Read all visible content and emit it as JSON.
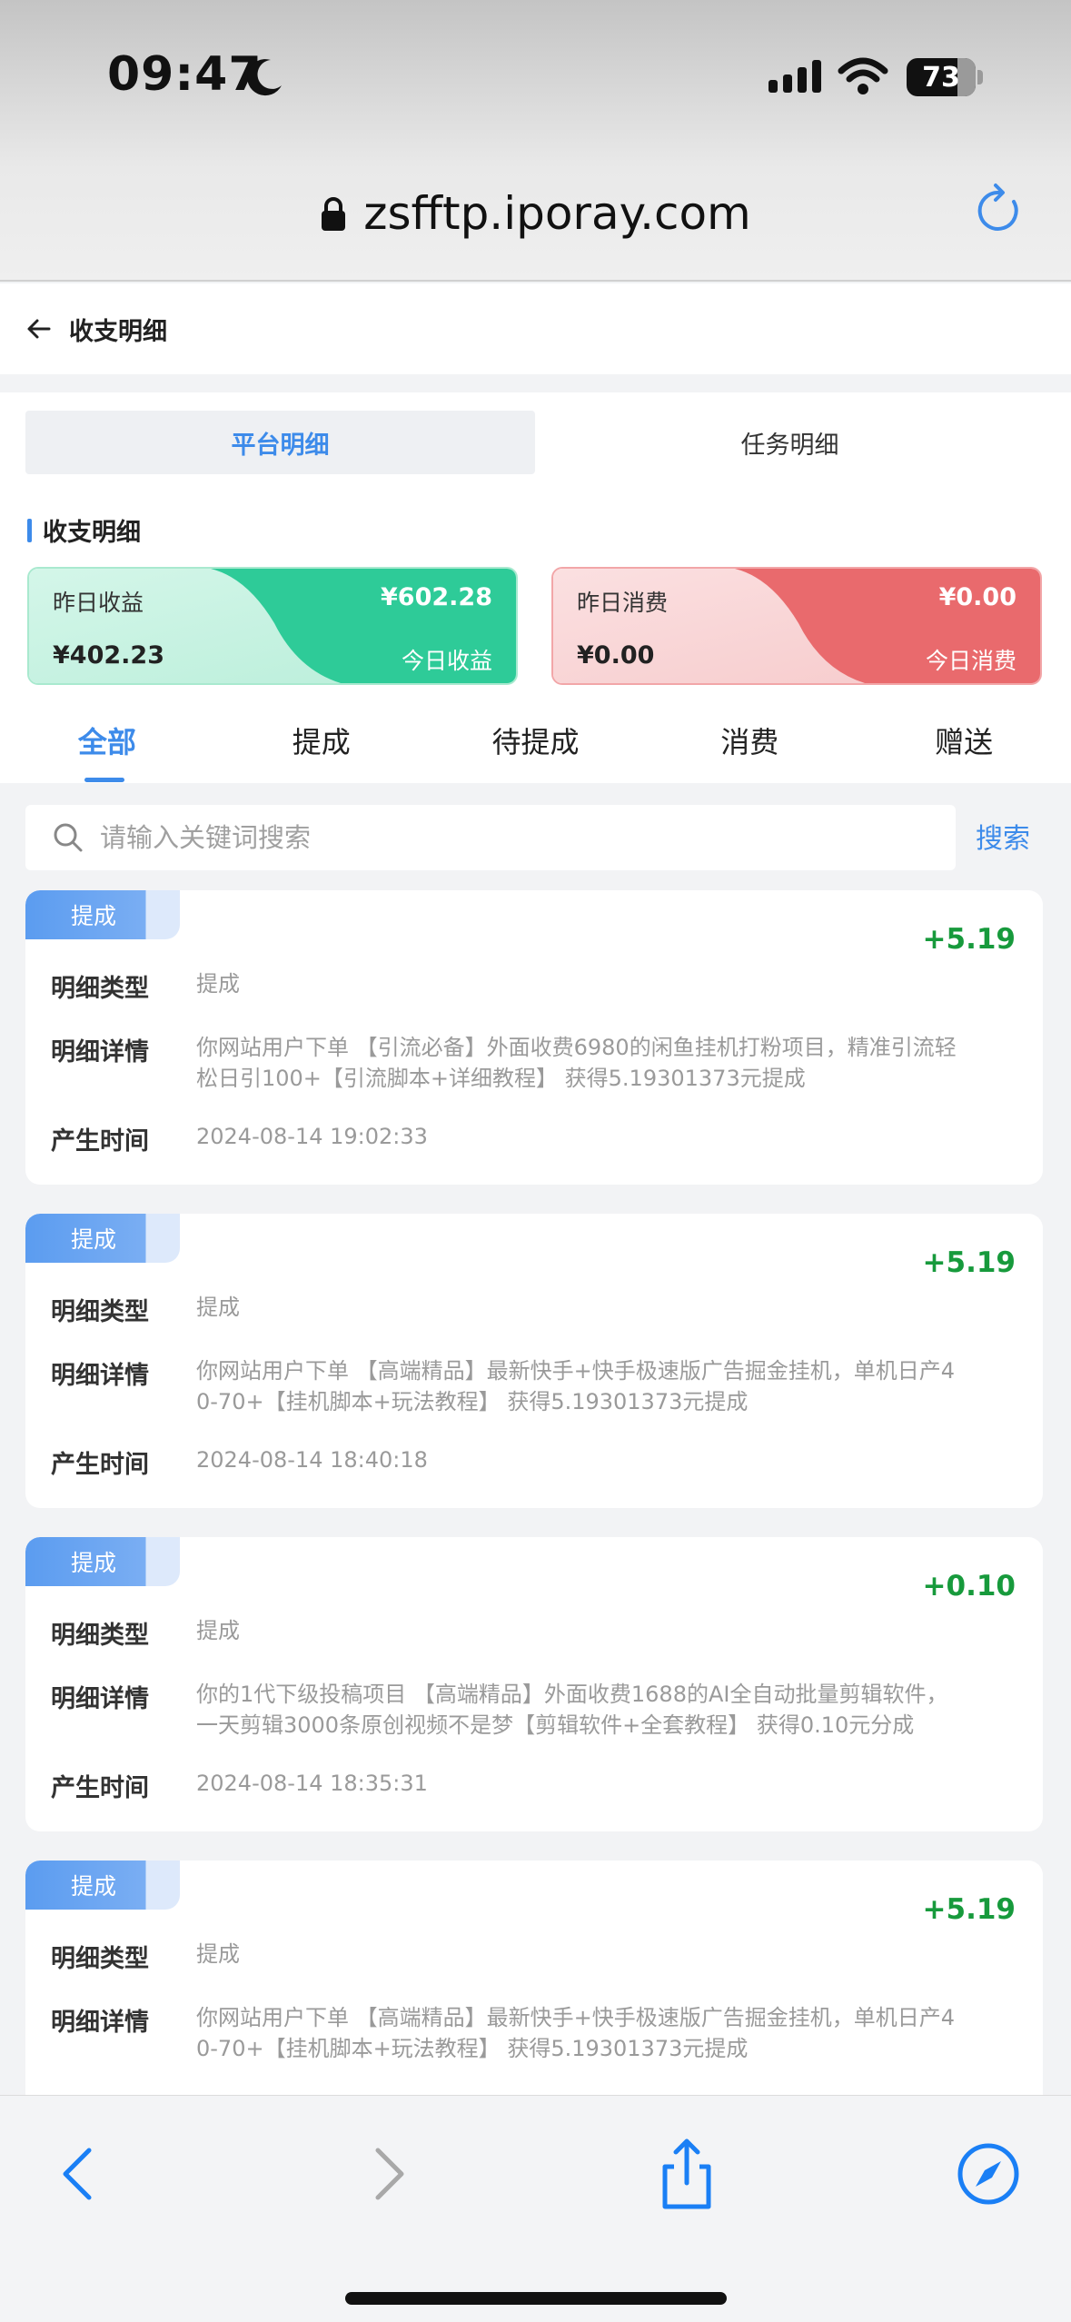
{
  "status": {
    "time": "09:47",
    "battery": "73"
  },
  "browser": {
    "url": "zsfftp.iporay.com"
  },
  "header": {
    "title": "收支明细"
  },
  "seg_tabs": [
    {
      "label": "平台明细",
      "active": true
    },
    {
      "label": "任务明细",
      "active": false
    }
  ],
  "section_title": "收支明细",
  "summary": {
    "green": {
      "top_left_label": "昨日收益",
      "top_right_amount": "¥602.28",
      "bottom_left_amount": "¥402.23",
      "bottom_right_label": "今日收益",
      "color": "#2ecb98"
    },
    "red": {
      "top_left_label": "昨日消费",
      "top_right_amount": "¥0.00",
      "bottom_left_amount": "¥0.00",
      "bottom_right_label": "今日消费",
      "color": "#e96a6d"
    }
  },
  "filter_tabs": [
    "全部",
    "提成",
    "待提成",
    "消费",
    "赠送"
  ],
  "search": {
    "placeholder": "请输入关键词搜索",
    "value": "",
    "button": "搜索"
  },
  "records": [
    {
      "tag": "提成",
      "amount": "+5.19",
      "type_label": "明细类型",
      "type_value": "提成",
      "detail_label": "明细详情",
      "detail_line1": "你网站用户下单 【引流必备】外面收费6980的闲鱼挂机打粉项目，精准引流轻",
      "detail_line2": "松日引100+【引流脚本+详细教程】 获得5.19301373元提成",
      "time_label": "产生时间",
      "time_value": "2024-08-14 19:02:33"
    },
    {
      "tag": "提成",
      "amount": "+5.19",
      "type_label": "明细类型",
      "type_value": "提成",
      "detail_label": "明细详情",
      "detail_line1": "你网站用户下单 【高端精品】最新快手+快手极速版广告掘金挂机，单机日产4",
      "detail_line2": "0-70+【挂机脚本+玩法教程】 获得5.19301373元提成",
      "time_label": "产生时间",
      "time_value": "2024-08-14 18:40:18"
    },
    {
      "tag": "提成",
      "amount": "+0.10",
      "type_label": "明细类型",
      "type_value": "提成",
      "detail_label": "明细详情",
      "detail_line1": "你的1代下级投稿项目 【高端精品】外面收费1688的AI全自动批量剪辑软件，",
      "detail_line2": "一天剪辑3000条原创视频不是梦【剪辑软件+全套教程】 获得0.10元分成",
      "time_label": "产生时间",
      "time_value": "2024-08-14 18:35:31"
    },
    {
      "tag": "提成",
      "amount": "+5.19",
      "type_label": "明细类型",
      "type_value": "提成",
      "detail_label": "明细详情",
      "detail_line1": "你网站用户下单 【高端精品】最新快手+快手极速版广告掘金挂机，单机日产4",
      "detail_line2": "0-70+【挂机脚本+玩法教程】 获得5.19301373元提成",
      "time_label": "",
      "time_value": ""
    }
  ],
  "colors": {
    "accent": "#3d8bea",
    "positive": "#179a3c"
  },
  "bottom_bar": {
    "icons": [
      "back-icon",
      "forward-icon",
      "share-icon",
      "compass-icon"
    ]
  }
}
